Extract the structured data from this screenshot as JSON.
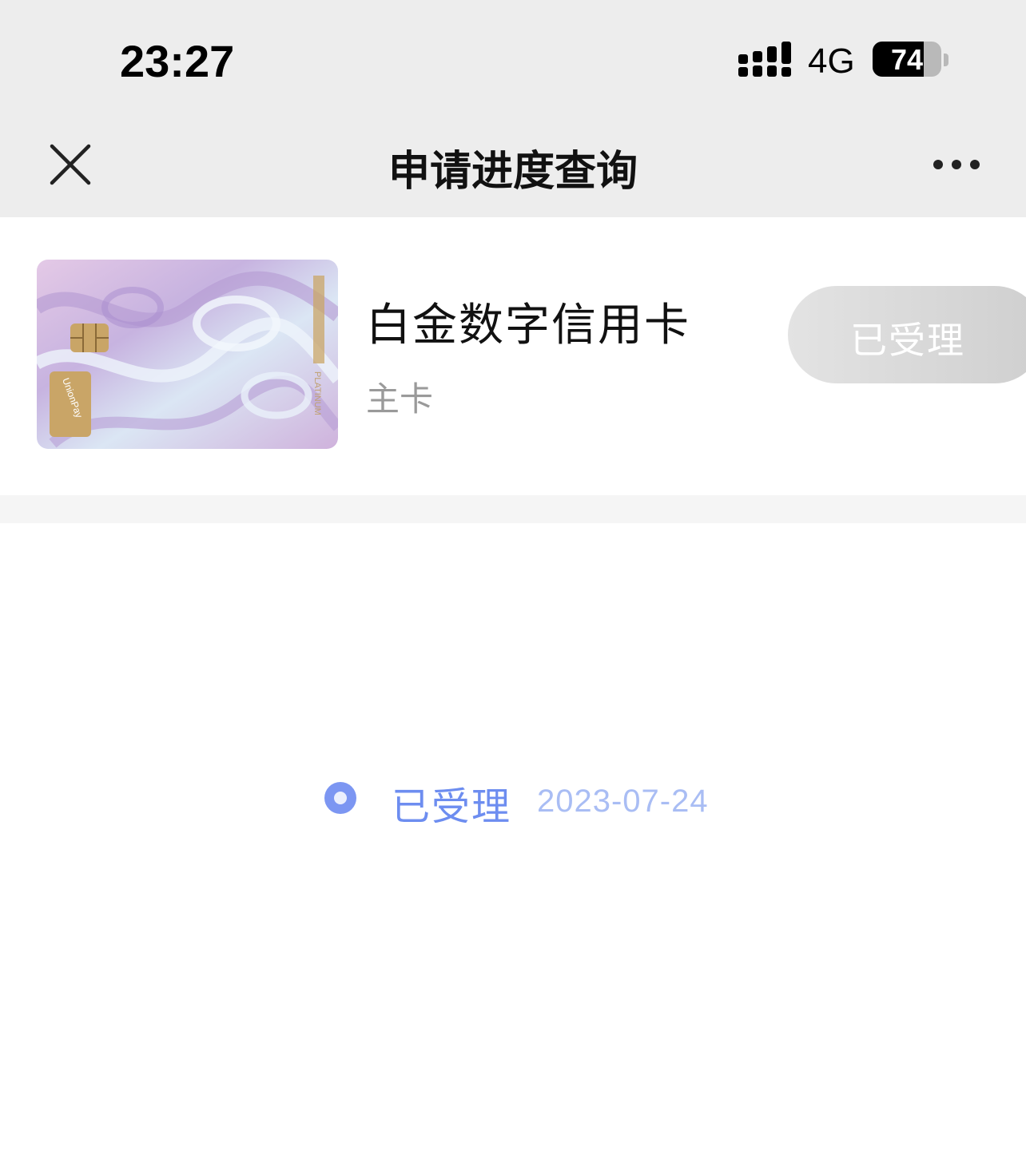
{
  "status_bar": {
    "time": "23:27",
    "network": "4G",
    "battery": "74",
    "battery_level": 0.74
  },
  "nav": {
    "title": "申请进度查询",
    "close_icon": "close-icon",
    "more_icon": "more-horizontal-icon"
  },
  "card": {
    "name": "白金数字信用卡",
    "type": "主卡",
    "status": "已受理",
    "image_icon": "credit-card-image"
  },
  "timeline": {
    "label": "已受理",
    "date": "2023-07-24",
    "accent": "#6d8df0"
  }
}
